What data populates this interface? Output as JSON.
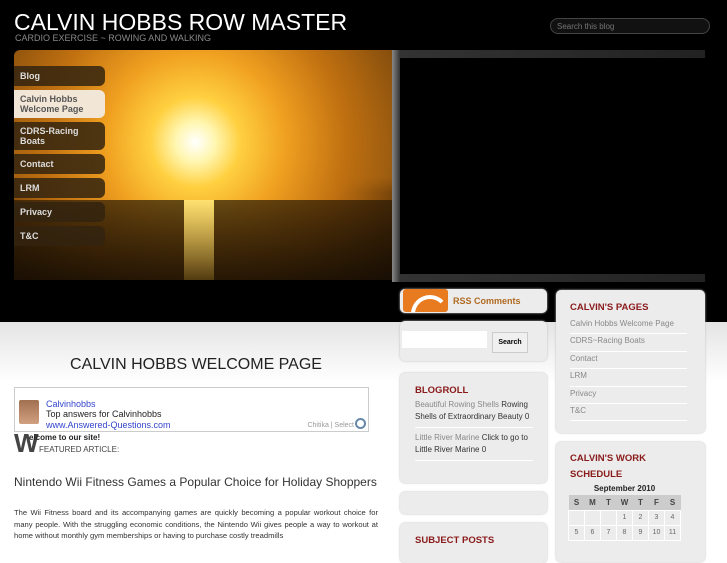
{
  "header": {
    "title": "CALVIN HOBBS ROW MASTER",
    "tagline": "CARDIO EXERCISE ~ ROWING AND WALKING",
    "search_placeholder": "Search this blog"
  },
  "nav": [
    {
      "label": "Blog"
    },
    {
      "label": "Calvin Hobbs Welcome Page",
      "active": true
    },
    {
      "label": "CDRS-Racing Boats"
    },
    {
      "label": "Contact"
    },
    {
      "label": "LRM"
    },
    {
      "label": "Privacy"
    },
    {
      "label": "T&C"
    }
  ],
  "main": {
    "page_title": "CALVIN HOBBS WELCOME PAGE",
    "chitika": {
      "name": "Calvinhobbs",
      "desc": "Top answers for Calvinhobbs",
      "url": "www.Answered-Questions.com",
      "brand": "Chitika | Select"
    },
    "dropcap": "W",
    "welcome": "elcome to our site!",
    "featured": "FEATURED ARTICLE:",
    "article_title": "Nintendo Wii Fitness Games a Popular Choice for Holiday Shoppers",
    "article_body": "The Wii Fitness board and its accompanying games are quickly becoming a popular workout choice for many people. With the struggling economic conditions, the Nintendo Wii gives people a way to workout at home without monthly gym memberships or having to purchase costly treadmills"
  },
  "sidebar": {
    "rss_label": "RSS Comments",
    "search_button": "Search",
    "blogroll": {
      "title": "BLOGROLL",
      "entries": [
        {
          "link": "Beautiful Rowing Shells",
          "desc": "Rowing Shells of Extraordinary Beauty",
          "count": "0"
        },
        {
          "link": "Little River Marine",
          "desc": "Click to go to Little River Marine",
          "count": "0"
        }
      ]
    },
    "subject_posts_title": "SUBJECT POSTS",
    "pages": {
      "title": "CALVIN'S PAGES",
      "items": [
        "Calvin Hobbs Welcome Page",
        "CDRS~Racing Boats",
        "Contact",
        "LRM",
        "Privacy",
        "T&C"
      ]
    },
    "schedule": {
      "title": "CALVIN'S WORK SCHEDULE",
      "month": "September 2010",
      "days": [
        "S",
        "M",
        "T",
        "W",
        "T",
        "F",
        "S"
      ],
      "weeks": [
        [
          "",
          "",
          "",
          "1",
          "2",
          "3",
          "4"
        ],
        [
          "5",
          "6",
          "7",
          "8",
          "9",
          "10",
          "11"
        ]
      ]
    }
  }
}
